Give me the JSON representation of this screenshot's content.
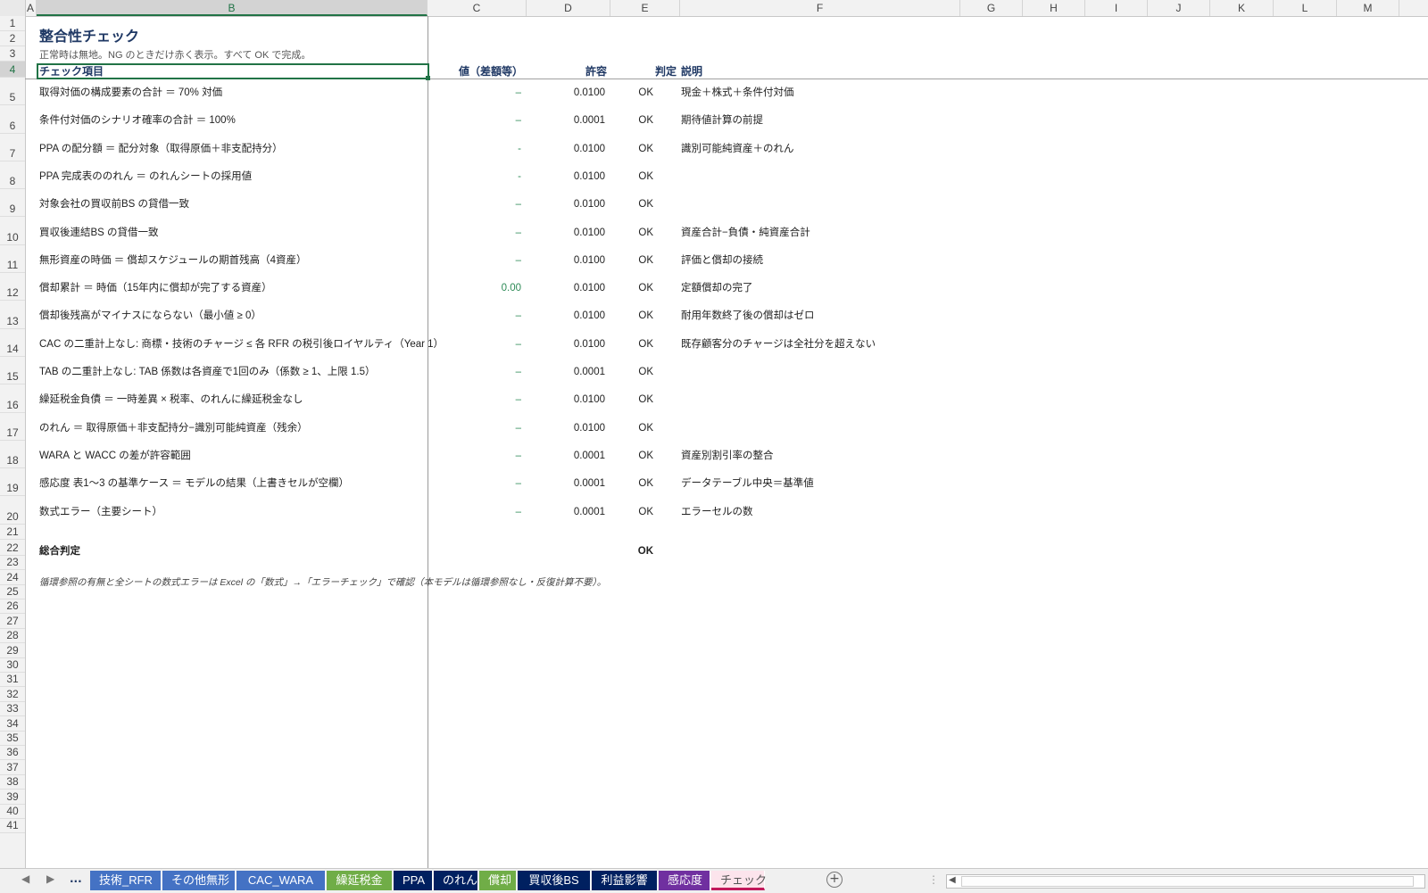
{
  "columns": [
    "A",
    "B",
    "C",
    "D",
    "E",
    "F",
    "G",
    "H",
    "I",
    "J",
    "K",
    "L",
    "M"
  ],
  "active_column": "B",
  "active_row": "4",
  "rows": [
    "1",
    "2",
    "3",
    "4",
    "5",
    "6",
    "7",
    "8",
    "9",
    "10",
    "11",
    "12",
    "13",
    "14",
    "15",
    "16",
    "17",
    "18",
    "19",
    "20",
    "21",
    "22",
    "23",
    "24",
    "25",
    "26",
    "27",
    "28",
    "29",
    "30",
    "31",
    "32",
    "33",
    "34",
    "35",
    "36",
    "37",
    "38",
    "39",
    "40",
    "41"
  ],
  "sheet": {
    "title": "整合性チェック",
    "subtitle": "正常時は無地。NG のときだけ赤く表示。すべて OK で完成。",
    "headers": {
      "item": "チェック項目",
      "value": "値（差額等）",
      "tolerance": "許容",
      "judge": "判定",
      "desc": "説明"
    },
    "checks": [
      {
        "item": "取得対価の構成要素の合計 ＝ 70% 対価",
        "value": "–",
        "tolerance": "0.0100",
        "judge": "OK",
        "desc": "現金＋株式＋条件付対価"
      },
      {
        "item": "条件付対価のシナリオ確率の合計 ＝ 100%",
        "value": "–",
        "tolerance": "0.0001",
        "judge": "OK",
        "desc": "期待値計算の前提"
      },
      {
        "item": "PPA の配分額 ＝ 配分対象（取得原価＋非支配持分）",
        "value": "-",
        "tolerance": "0.0100",
        "judge": "OK",
        "desc": "識別可能純資産＋のれん"
      },
      {
        "item": "PPA 完成表ののれん ＝ のれんシートの採用値",
        "value": "-",
        "tolerance": "0.0100",
        "judge": "OK",
        "desc": ""
      },
      {
        "item": "対象会社の買収前BS の貸借一致",
        "value": "–",
        "tolerance": "0.0100",
        "judge": "OK",
        "desc": ""
      },
      {
        "item": "買収後連結BS の貸借一致",
        "value": "–",
        "tolerance": "0.0100",
        "judge": "OK",
        "desc": "資産合計−負債・純資産合計"
      },
      {
        "item": "無形資産の時価 ＝ 償却スケジュールの期首残高（4資産）",
        "value": "–",
        "tolerance": "0.0100",
        "judge": "OK",
        "desc": "評価と償却の接続"
      },
      {
        "item": "償却累計 ＝ 時価（15年内に償却が完了する資産）",
        "value": "0.00",
        "tolerance": "0.0100",
        "judge": "OK",
        "desc": "定額償却の完了"
      },
      {
        "item": "償却後残高がマイナスにならない（最小値 ≥ 0）",
        "value": "–",
        "tolerance": "0.0100",
        "judge": "OK",
        "desc": "耐用年数終了後の償却はゼロ"
      },
      {
        "item": "CAC の二重計上なし: 商標・技術のチャージ ≤ 各 RFR の税引後ロイヤルティ（Year 1）",
        "value": "–",
        "tolerance": "0.0100",
        "judge": "OK",
        "desc": "既存顧客分のチャージは全社分を超えない"
      },
      {
        "item": "TAB の二重計上なし: TAB 係数は各資産で1回のみ（係数 ≥ 1、上限 1.5）",
        "value": "–",
        "tolerance": "0.0001",
        "judge": "OK",
        "desc": ""
      },
      {
        "item": "繰延税金負債 ＝ 一時差異 × 税率、のれんに繰延税金なし",
        "value": "–",
        "tolerance": "0.0100",
        "judge": "OK",
        "desc": ""
      },
      {
        "item": "のれん ＝ 取得原価＋非支配持分−識別可能純資産（残余）",
        "value": "–",
        "tolerance": "0.0100",
        "judge": "OK",
        "desc": ""
      },
      {
        "item": "WARA と WACC の差が許容範囲",
        "value": "–",
        "tolerance": "0.0001",
        "judge": "OK",
        "desc": "資産別割引率の整合"
      },
      {
        "item": "感応度 表1〜3 の基準ケース ＝ モデルの結果（上書きセルが空欄）",
        "value": "–",
        "tolerance": "0.0001",
        "judge": "OK",
        "desc": "データテーブル中央＝基準値"
      },
      {
        "item": "数式エラー（主要シート）",
        "value": "–",
        "tolerance": "0.0001",
        "judge": "OK",
        "desc": "エラーセルの数"
      }
    ],
    "overall_label": "総合判定",
    "overall_value": "OK",
    "note": "循環参照の有無と全シートの数式エラーは Excel の「数式」→「エラーチェック」で確認（本モデルは循環参照なし・反復計算不要）。"
  },
  "tabs": {
    "nav_prev": "◀",
    "nav_next": "▶",
    "ellipsis": "...",
    "add_icon": "add-sheet-icon",
    "items": [
      {
        "label": "技術_RFR",
        "color": "#4472c4"
      },
      {
        "label": "その他無形",
        "color": "#4472c4"
      },
      {
        "label": "CAC_WARA",
        "color": "#4472c4"
      },
      {
        "label": "繰延税金",
        "color": "#70ad47"
      },
      {
        "label": "PPA",
        "color": "#002060"
      },
      {
        "label": "のれん",
        "color": "#002060"
      },
      {
        "label": "償却",
        "color": "#70ad47"
      },
      {
        "label": "買収後BS",
        "color": "#002060"
      },
      {
        "label": "利益影響",
        "color": "#002060"
      },
      {
        "label": "感応度",
        "color": "#7030a0"
      },
      {
        "label": "チェック",
        "color": "#fce4ec",
        "active": true
      }
    ]
  },
  "colors": {
    "accent_green": "#217346",
    "title_navy": "#1f3864",
    "value_green": "#2e8b57"
  }
}
